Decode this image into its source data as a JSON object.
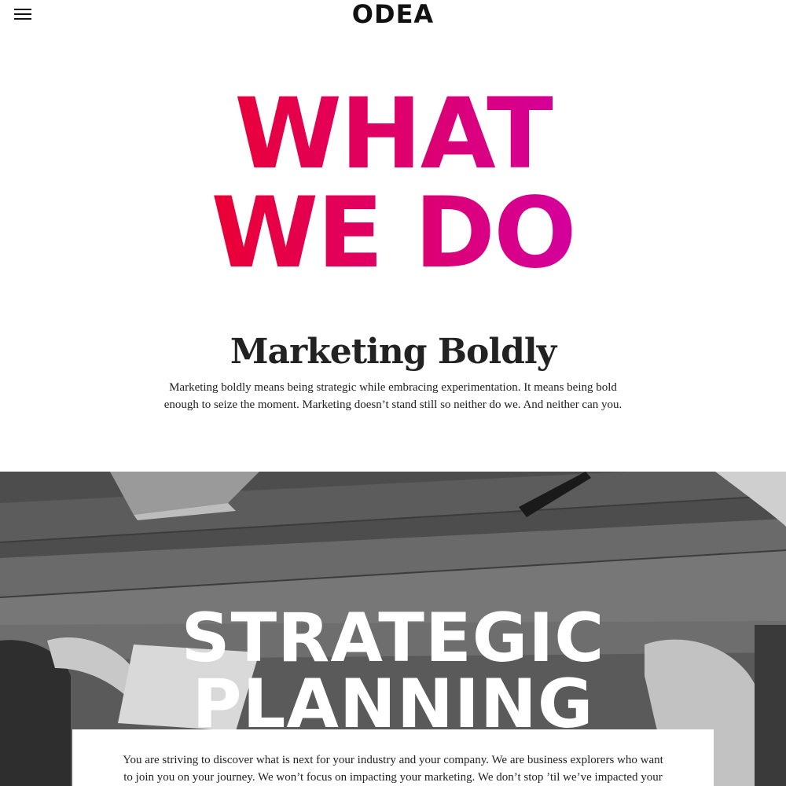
{
  "header": {
    "menu_icon": "hamburger-menu-icon",
    "logo_text": "ODEA"
  },
  "hero": {
    "title_line1": "WHAT",
    "title_line2": "WE DO",
    "gradient_start": "#ea0036",
    "gradient_end": "#d4009a"
  },
  "intro": {
    "heading": "Marketing Boldly",
    "body": "Marketing boldly means being strategic while embracing experimentation. It means being bold enough to seize the moment. Marketing doesn’t stand still so neither do we. And neither can you."
  },
  "strategic_section": {
    "title_line1": "STRATEGIC",
    "title_line2": "PLANNING",
    "body": "You are striving to discover what is next for your industry and your company. We are business explorers who want to join you on your journey. We won’t focus on impacting your marketing. We don’t stop ’til we’ve impacted your"
  }
}
